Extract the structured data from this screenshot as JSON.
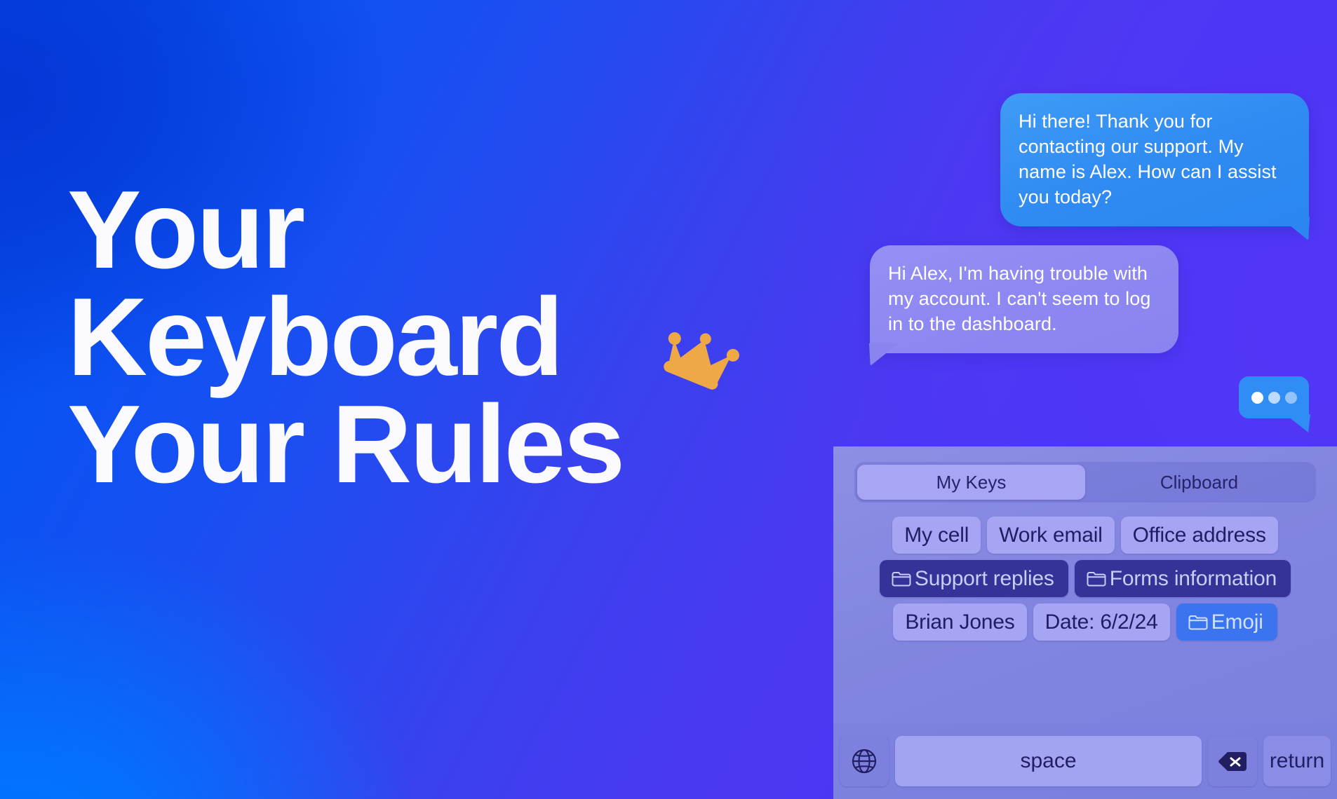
{
  "background": {
    "gradient_from": "#0076ff",
    "gradient_mid": "#0540d8",
    "gradient_to": "#4d36f5"
  },
  "headline": {
    "line1": "Your",
    "line2": "Keyboard",
    "line3": "Your Rules",
    "crown_icon": "crown-icon",
    "text_color": "#fafaff"
  },
  "chat": {
    "messages": [
      {
        "sender": "agent",
        "text": "Hi there! Thank you for contacting our support. My name is Alex. How can I assist you today?",
        "color": "#2f8af2"
      },
      {
        "sender": "user",
        "text": "Hi Alex, I'm having trouble with my account. I can't seem to log in to the dashboard.",
        "color": "#8d87f2"
      }
    ],
    "typing_indicator": {
      "icon": "typing-dots-icon",
      "dots": 3,
      "color": "#2f8df5"
    }
  },
  "keyboard": {
    "background": "#8285e0",
    "tabs": [
      {
        "label": "My Keys",
        "active": true
      },
      {
        "label": "Clipboard",
        "active": false
      }
    ],
    "rows": [
      {
        "chips": [
          {
            "label": "My cell",
            "type": "snippet"
          },
          {
            "label": "Work email",
            "type": "snippet"
          },
          {
            "label": "Office address",
            "type": "snippet"
          }
        ]
      },
      {
        "chips": [
          {
            "label": "Support replies",
            "type": "folder",
            "icon": "folder-icon"
          },
          {
            "label": "Forms information",
            "type": "folder",
            "icon": "folder-icon"
          }
        ]
      },
      {
        "chips": [
          {
            "label": "Brian Jones",
            "type": "snippet"
          },
          {
            "label": "Date: 6/2/24",
            "type": "snippet"
          },
          {
            "label": "Emoji",
            "type": "folder-accent",
            "icon": "folder-icon"
          }
        ]
      }
    ],
    "bottom_row": {
      "globe_label": "",
      "globe_icon": "globe-icon",
      "space_label": "space",
      "delete_icon": "backspace-icon",
      "return_label": "return"
    }
  }
}
